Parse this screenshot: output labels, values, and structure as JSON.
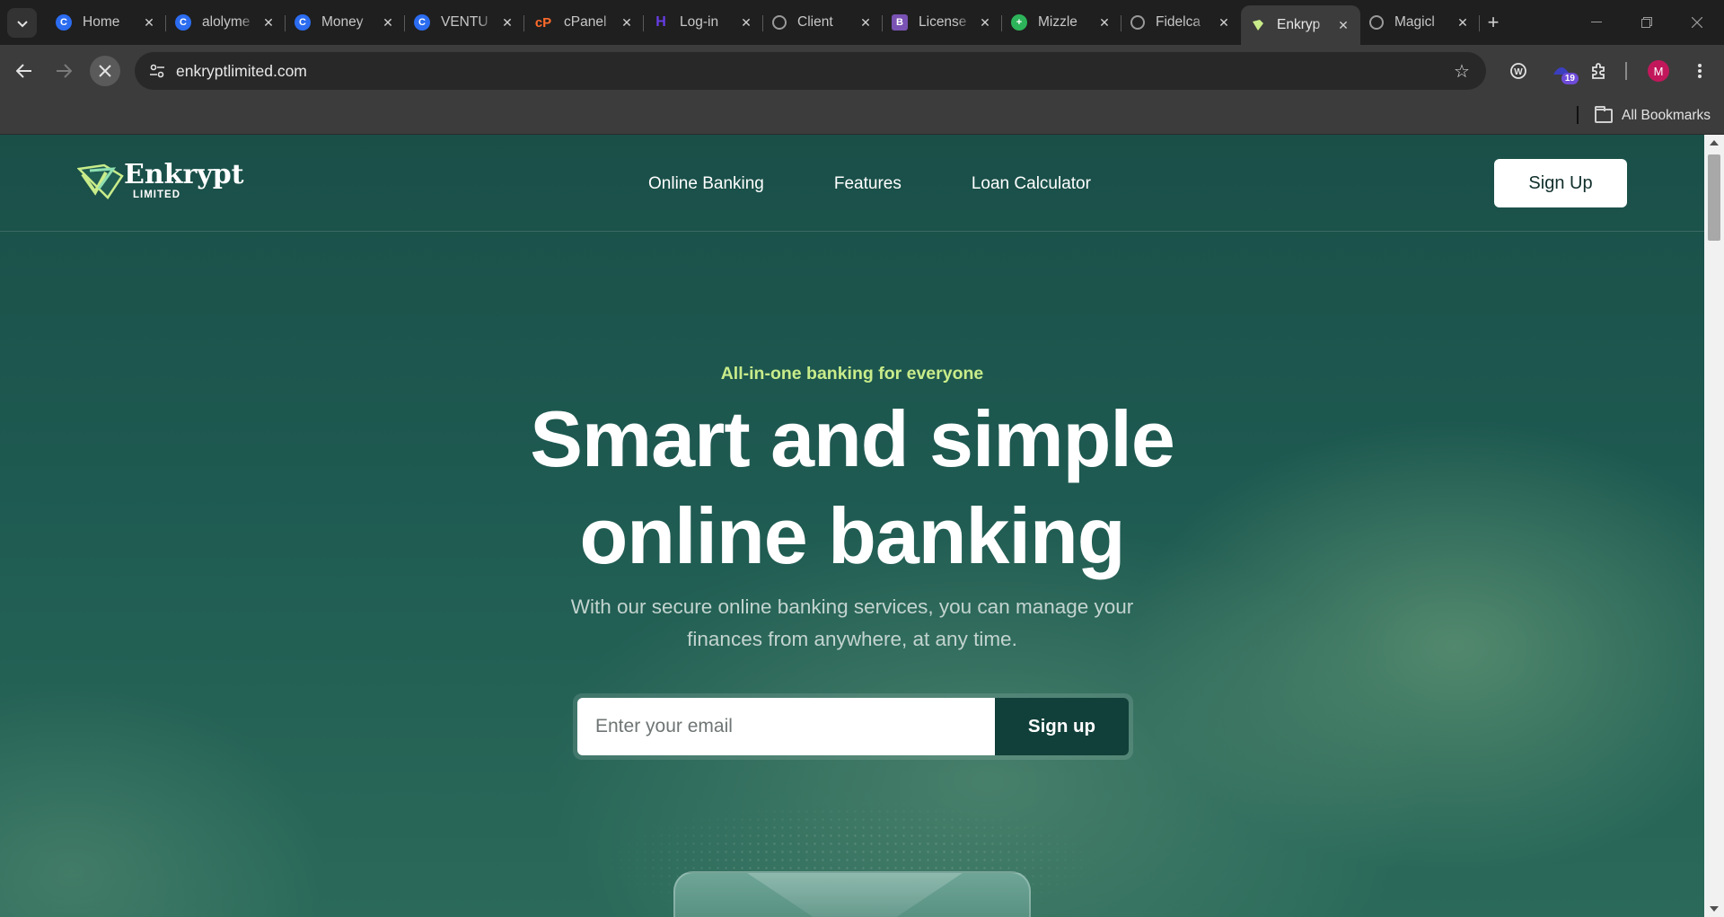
{
  "browser": {
    "tabs": [
      {
        "title": "Home",
        "favicon": "c-logo-icon",
        "color": "#2b6cf0"
      },
      {
        "title": "alolyme",
        "favicon": "c-logo-icon",
        "color": "#2b6cf0"
      },
      {
        "title": "Money",
        "favicon": "c-logo-icon",
        "color": "#2b6cf0"
      },
      {
        "title": "VENTU",
        "favicon": "c-logo-icon",
        "color": "#2b6cf0"
      },
      {
        "title": "cPanel",
        "favicon": "cpanel-icon",
        "color": "#ff6c2c"
      },
      {
        "title": "Log-in",
        "favicon": "hostinger-icon",
        "color": "#673de6"
      },
      {
        "title": "Client",
        "favicon": "globe-icon",
        "color": "#9a9a9a"
      },
      {
        "title": "License",
        "favicon": "bootstrap-icon",
        "color": "#7952b3"
      },
      {
        "title": "Mizzle",
        "favicon": "mizzle-icon",
        "color": "#2db45a"
      },
      {
        "title": "Fidelca",
        "favicon": "globe-icon",
        "color": "#9a9a9a"
      },
      {
        "title": "Enkryp",
        "favicon": "enkrypt-icon",
        "color": "#c9ec8a",
        "active": true
      },
      {
        "title": "Magicl",
        "favicon": "globe-icon",
        "color": "#9a9a9a"
      }
    ],
    "url": "enkryptlimited.com",
    "extension_badge": "19",
    "profile_initial": "M",
    "bookmarks_label": "All Bookmarks"
  },
  "site": {
    "logo": {
      "name": "Enkrypt",
      "sub": "LIMITED"
    },
    "nav": [
      "Online Banking",
      "Features",
      "Loan Calculator"
    ],
    "signup_top": "Sign Up",
    "hero": {
      "eyebrow": "All-in-one banking for everyone",
      "headline_line1": "Smart and simple",
      "headline_line2": "online banking",
      "subtext": "With our secure online banking services, you can manage your finances from anywhere, at any time.",
      "email_placeholder": "Enter your email",
      "signup_button": "Sign up"
    },
    "colors": {
      "accent": "#c9ec8a",
      "dark_green": "#113f39",
      "background": "#1e5a51"
    }
  }
}
